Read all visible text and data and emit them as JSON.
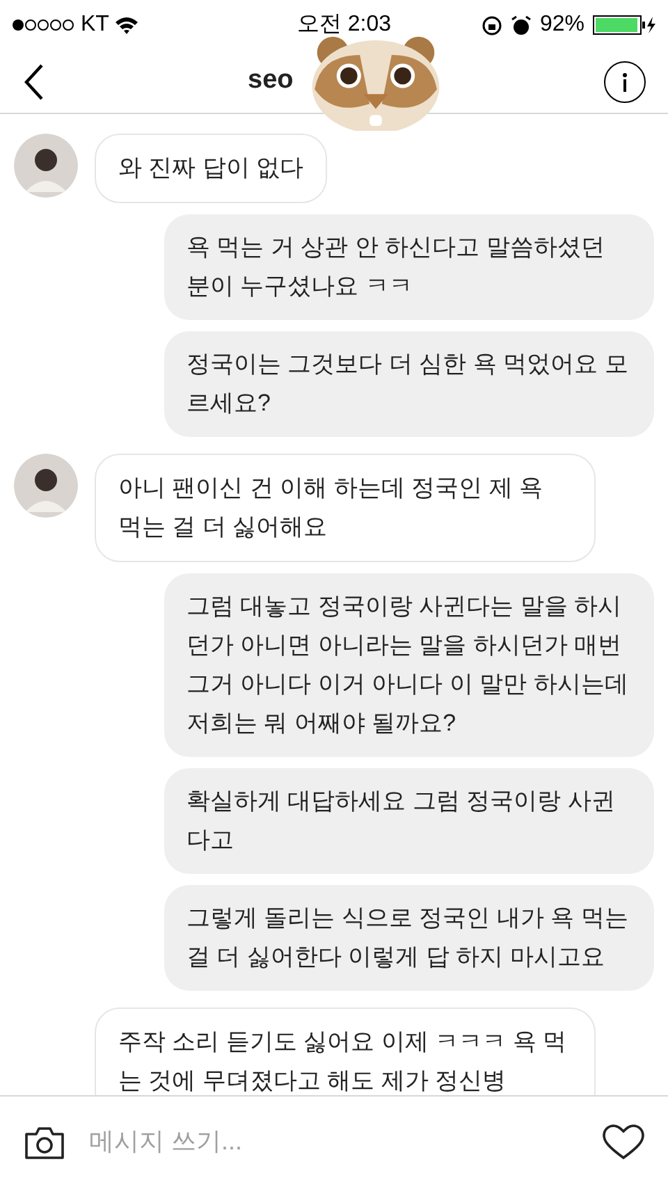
{
  "status_bar": {
    "carrier": "KT",
    "time": "오전 2:03",
    "battery": "92%"
  },
  "header": {
    "title": "seo"
  },
  "messages": [
    {
      "kind": "received",
      "avatar": true,
      "text": "와 진짜 답이 없다"
    },
    {
      "kind": "sent",
      "text": "욕 먹는 거 상관 안 하신다고 말씀하셨던 분이 누구셨나요 ㅋㅋ"
    },
    {
      "kind": "sent",
      "text": "정국이는 그것보다 더 심한 욕 먹었어요 모르세요?"
    },
    {
      "kind": "received",
      "avatar": true,
      "text": "아니 팬이신 건 이해 하는데 정국인 제 욕 먹는 걸 더 싫어해요"
    },
    {
      "kind": "sent",
      "text": "그럼 대놓고 정국이랑 사귄다는 말을 하시던가 아니면 아니라는 말을 하시던가 매번 그거 아니다 이거 아니다 이 말만 하시는데 저희는 뭐 어째야 될까요?"
    },
    {
      "kind": "sent",
      "text": "확실하게 대답하세요 그럼 정국이랑 사귄다고"
    },
    {
      "kind": "sent",
      "text": "그렇게 돌리는 식으로 정국인 내가 욕 먹는 걸 더 싫어한다 이렇게 답 하지 마시고요"
    },
    {
      "kind": "received",
      "avatar": false,
      "text": "주작 소리 듣기도 싫어요 이제 ㅋㅋㅋ 욕 먹는 것에 무뎌졌다고 해도 제가 정신병"
    }
  ],
  "composer": {
    "placeholder": "메시지 쓰기..."
  }
}
